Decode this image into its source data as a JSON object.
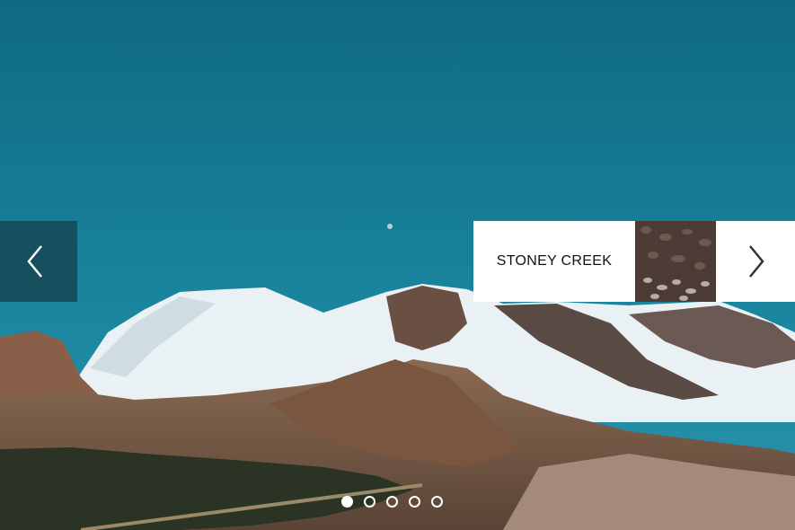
{
  "slider": {
    "next_slide_title": "STONEY CREEK",
    "dots": [
      {
        "active": true
      },
      {
        "active": false
      },
      {
        "active": false
      },
      {
        "active": false
      },
      {
        "active": false
      }
    ]
  },
  "icons": {
    "prev": "chevron-left-icon",
    "next": "chevron-right-icon"
  },
  "colors": {
    "sky": "#1a7a90",
    "prev_button_bg": "#164652",
    "next_panel_bg": "#ffffff"
  }
}
